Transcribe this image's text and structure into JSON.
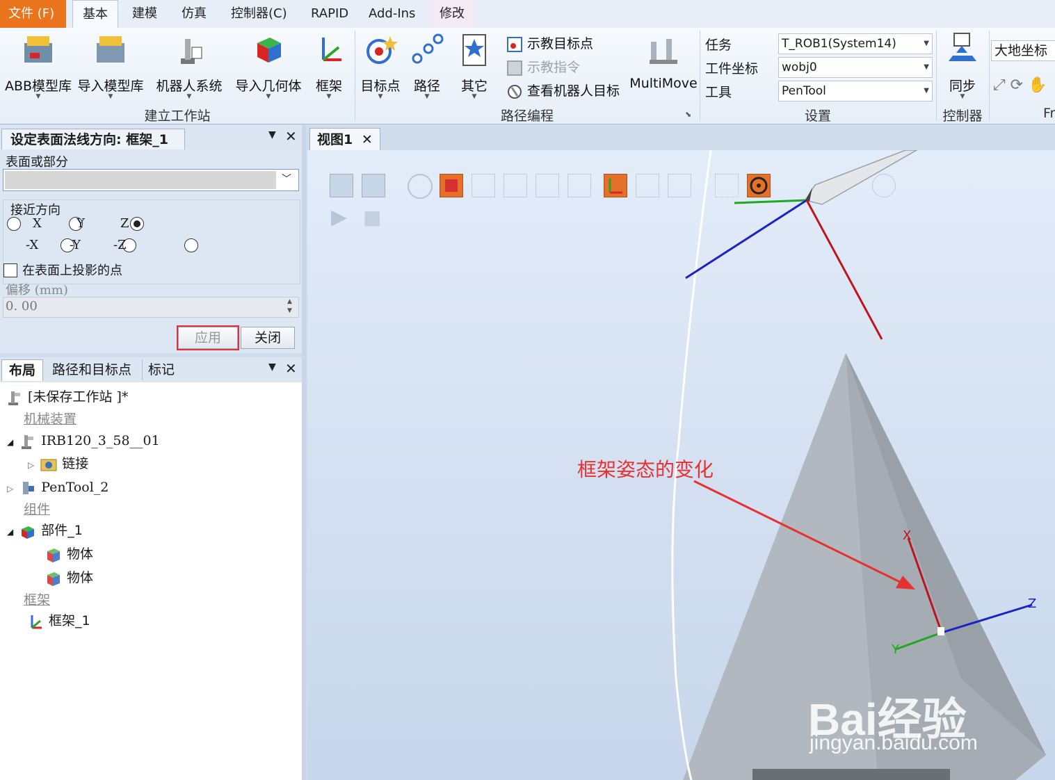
{
  "ribbon": {
    "tabs": [
      {
        "label": "文件 (F)",
        "kind": "file"
      },
      {
        "label": "基本",
        "kind": "active"
      },
      {
        "label": "建模"
      },
      {
        "label": "仿真"
      },
      {
        "label": "控制器(C)"
      },
      {
        "label": "RAPID"
      },
      {
        "label": "Add-Ins"
      },
      {
        "label": "修改"
      }
    ],
    "build_station": {
      "group_label": "建立工作站",
      "abb_library": "ABB模型库",
      "import_library": "导入模型库",
      "robot_system": "机器人系统",
      "import_geometry": "导入几何体",
      "frame": "框架"
    },
    "path_programming": {
      "group_label": "路径编程",
      "target": "目标点",
      "path": "路径",
      "other": "其它",
      "teach_target": "示教目标点",
      "teach_instruction": "示教指令",
      "view_robot_target": "查看机器人目标",
      "multimove": "MultiMove"
    },
    "settings": {
      "group_label": "设置",
      "task_label": "任务",
      "task_value": "T_ROB1(System14)",
      "wobj_label": "工件坐标",
      "wobj_value": "wobj0",
      "tool_label": "工具",
      "tool_value": "PenTool"
    },
    "controller": {
      "group_label": "控制器",
      "sync": "同步"
    },
    "freehand": {
      "frame_select": "大地坐标",
      "group_label_partial": "Fr"
    }
  },
  "surface_panel": {
    "title": "设定表面法线方向: 框架_1",
    "surface_label": "表面或部分",
    "surface_value": "",
    "approach_label": "接近方向",
    "directions": [
      "X",
      "Y",
      "Z",
      "-X",
      "-Y",
      "-Z"
    ],
    "selected_direction": "Z",
    "project_label": "在表面上投影的点",
    "project_checked": false,
    "offset_label": "偏移 (mm)",
    "offset_value": "0. 00",
    "apply_label": "应用",
    "close_label": "关闭"
  },
  "layout_panel": {
    "tabs": [
      "布局",
      "路径和目标点",
      "标记"
    ],
    "station": "[未保存工作站 ]*",
    "cat_mechanisms": "机械装置",
    "robot": "IRB120_3_58__01",
    "links": "链接",
    "tool": "PenTool_2",
    "cat_components": "组件",
    "part": "部件_1",
    "body1": "物体",
    "body2": "物体",
    "cat_frames": "框架",
    "frame": "框架_1"
  },
  "view": {
    "tab_label": "视图1",
    "annotation": "框架姿态的变化",
    "axis_x": "X",
    "axis_y": "Y",
    "axis_z": "Z",
    "watermark_main": "Bai经验",
    "watermark_url": "jingyan.baidu.com",
    "colors": {
      "annotation": "#e8312f",
      "axis_x": "#c0141c",
      "axis_y": "#1ea81e",
      "axis_z": "#1a22c8"
    }
  }
}
